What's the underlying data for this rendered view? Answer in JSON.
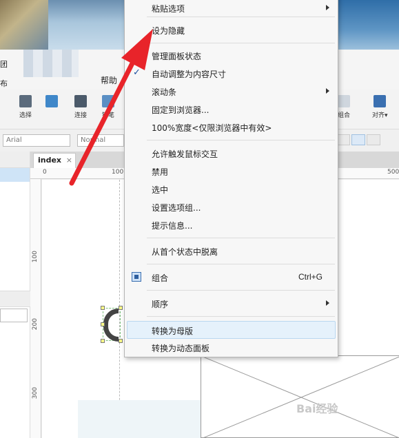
{
  "app": {
    "menu_left_labels": [
      "团",
      "布"
    ],
    "help_menu": "帮助",
    "toolbar": [
      {
        "label": "选择",
        "icon": "select-icon"
      },
      {
        "label": "连接",
        "icon": "connect-icon"
      },
      {
        "label": "钢笔",
        "icon": "pen-icon"
      },
      {
        "label": "组合",
        "icon": "group-icon"
      },
      {
        "label": "对齐▾",
        "icon": "align-icon"
      }
    ],
    "font_select": "Arial",
    "style_select": "Normal",
    "tab": {
      "label": "index",
      "close": "×"
    },
    "ruler_top": [
      "0",
      "100",
      "500"
    ],
    "ruler_left": [
      "100",
      "200",
      "300"
    ],
    "watermark": "Bai经验"
  },
  "context_menu": {
    "items": [
      {
        "id": "paste-options",
        "label": "粘贴选项",
        "submenu": true
      },
      {
        "id": "set-hidden",
        "label": "设为隐藏"
      },
      {
        "id": "manage-panel-states",
        "label": "管理面板状态"
      },
      {
        "id": "auto-fit-content",
        "label": "自动调整为内容尺寸",
        "checked": true,
        "check_mark": "✓"
      },
      {
        "id": "scrollbar",
        "label": "滚动条",
        "submenu": true
      },
      {
        "id": "pin-to-browser",
        "label": "固定到浏览器..."
      },
      {
        "id": "full-width",
        "label": "100%宽度<仅限浏览器中有效>"
      },
      {
        "id": "allow-mouse-interaction",
        "label": "允许触发鼠标交互"
      },
      {
        "id": "disable",
        "label": "禁用"
      },
      {
        "id": "selected",
        "label": "选中"
      },
      {
        "id": "set-option-group",
        "label": "设置选项组..."
      },
      {
        "id": "tooltip",
        "label": "提示信息..."
      },
      {
        "id": "detach-first-state",
        "label": "从首个状态中脱离"
      },
      {
        "id": "group",
        "label": "组合",
        "shortcut": "Ctrl+G",
        "icon": "group-icon"
      },
      {
        "id": "order",
        "label": "顺序",
        "submenu": true
      },
      {
        "id": "convert-to-master",
        "label": "转换为母版",
        "highlighted": true
      },
      {
        "id": "convert-to-dynamic-panel",
        "label": "转换为动态面板"
      }
    ]
  },
  "colors": {
    "annotation_arrow": "#e8242a",
    "menu_highlight": "#e5f1fb",
    "check": "#1a4fa0"
  }
}
